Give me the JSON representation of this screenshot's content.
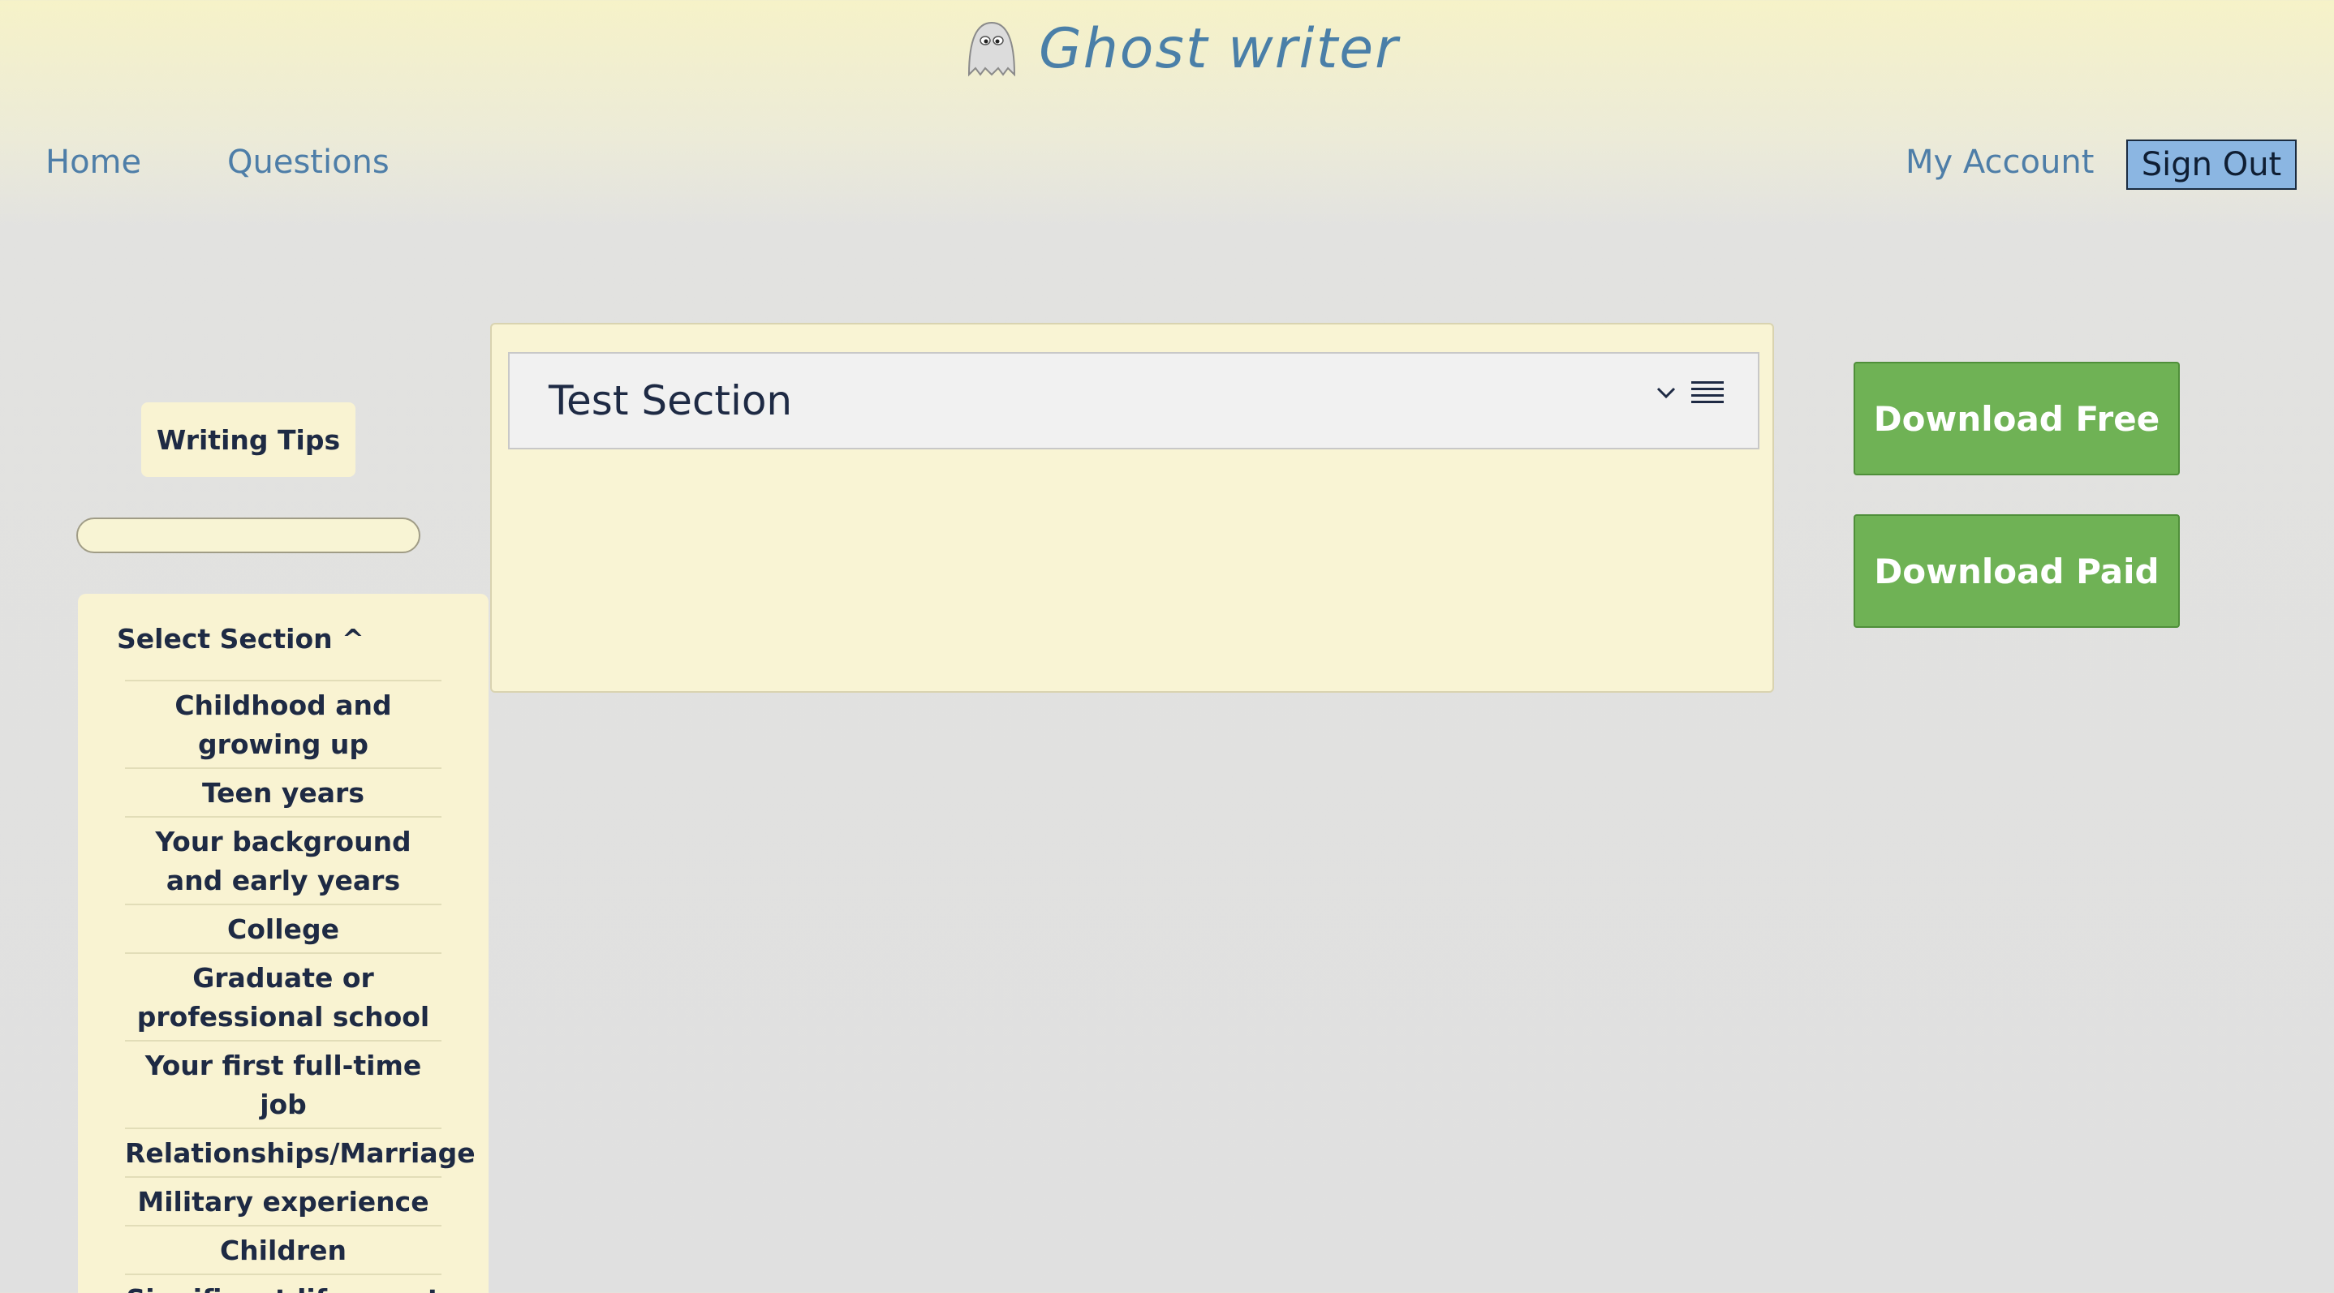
{
  "header": {
    "logo_text": "Ghost writer",
    "logo_icon": "ghost-icon"
  },
  "nav": {
    "home": "Home",
    "questions": "Questions",
    "my_account": "My Account",
    "sign_out": "Sign Out"
  },
  "sidebar": {
    "writing_tips": "Writing Tips",
    "search_value": "",
    "select_section": "Select Section ^",
    "sections": [
      "Childhood and growing up",
      "Teen years",
      "Your background and early years",
      "College",
      "Graduate or professional school",
      "Your first full-time job",
      "Relationships/Marriage",
      "Military experience",
      "Children",
      "Significant life event"
    ]
  },
  "main": {
    "section_title": "Test Section",
    "icons": [
      "chevron-down-icon",
      "list-icon"
    ]
  },
  "actions": {
    "download_free": "Download Free",
    "download_paid": "Download Paid"
  },
  "colors": {
    "accent_blue": "#4e7ea8",
    "sign_out_bg": "#8bb6e2",
    "download_green": "#6fb255",
    "panel_cream": "#f9f3d2"
  }
}
